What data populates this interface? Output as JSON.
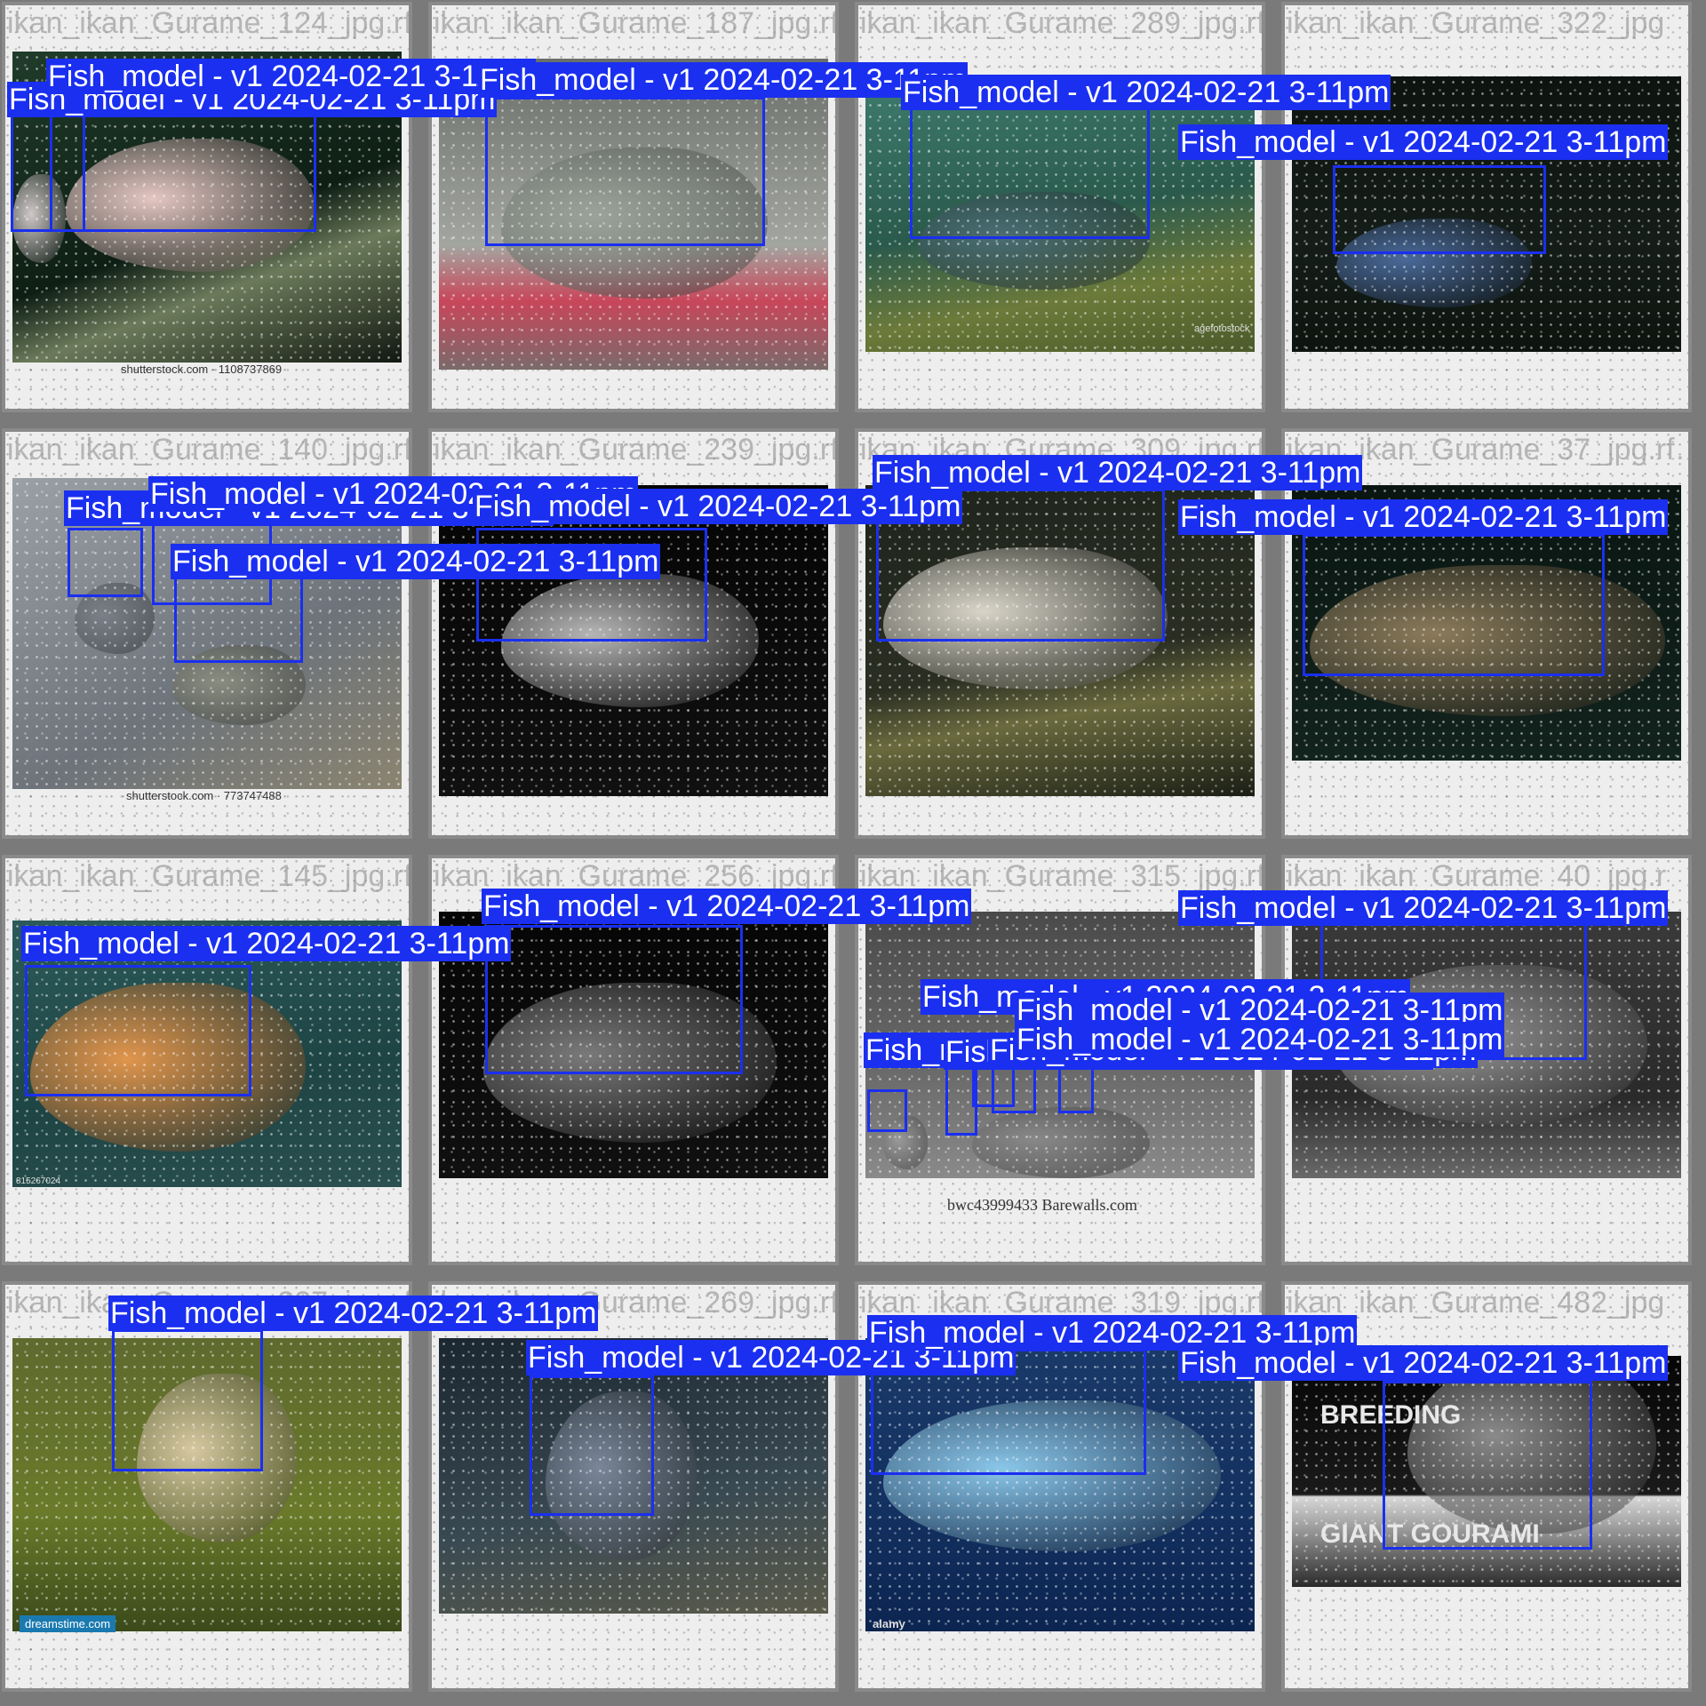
{
  "label_text": "Fish_model - v1 2024-02-21 3-11pm",
  "colors": {
    "box": "#1a2ff0",
    "label_bg": "#1a2ff0",
    "label_text": "#ffffff",
    "frame": "#8a8a8a"
  },
  "tiles": [
    {
      "filename": "ikan_ikan_Gurame_124_jpg.rf.1e3ea7a…",
      "watermark": "shutterstock.com · 1108737869"
    },
    {
      "filename": "ikan_ikan_Gurame_187_jpg.rf.7ab0542a734",
      "watermark": ""
    },
    {
      "filename": "ikan_ikan_Gurame_289_jpg.rf.a3da387d06fe",
      "watermark": ""
    },
    {
      "filename": "ikan_ikan_Gurame_322_jpg",
      "watermark": ""
    },
    {
      "filename": "ikan_ikan_Gurame_140_jpg.rf.a22da3f…",
      "watermark": "shutterstock.com · 773747488"
    },
    {
      "filename": "ikan_ikan_Gurame_239_jpg.rf.235ddd5c…",
      "watermark": ""
    },
    {
      "filename": "ikan_ikan_Gurame_309_jpg.rf.cfbfc7c…",
      "watermark": ""
    },
    {
      "filename": "ikan_ikan_Gurame_37_jpg.rf…",
      "watermark": ""
    },
    {
      "filename": "ikan_ikan_Gurame_145_jpg.rf.8c4a59c8f5…",
      "watermark": "815267024"
    },
    {
      "filename": "ikan_ikan_Gurame_256_jpg.rf.48dc15e30d48",
      "watermark": ""
    },
    {
      "filename": "ikan_ikan_Gurame_315_jpg.rf.00ca1960b17",
      "watermark": "bwc43999433 Barewalls.com"
    },
    {
      "filename": "ikan_ikan_Gurame_40_jpg.r",
      "watermark": ""
    },
    {
      "filename": "ikan_ikan_Gurame_227_jpg.rf.0102b69c1fe0",
      "watermark": "dreamstime.com"
    },
    {
      "filename": "ikan_ikan_Gurame_269_jpg.rf.3b7646a90ee",
      "watermark": ""
    },
    {
      "filename": "ikan_ikan_Gurame_319_jpg.rf.8b4a324a244",
      "watermark": "alamy"
    },
    {
      "filename": "ikan_ikan_Gurame_482_jpg",
      "watermark": ""
    }
  ],
  "poster_text": {
    "top": "BREEDING",
    "bottom": "GIANT GOURAMI"
  },
  "logo_marks": [
    "agefotostock",
    "alamy"
  ]
}
